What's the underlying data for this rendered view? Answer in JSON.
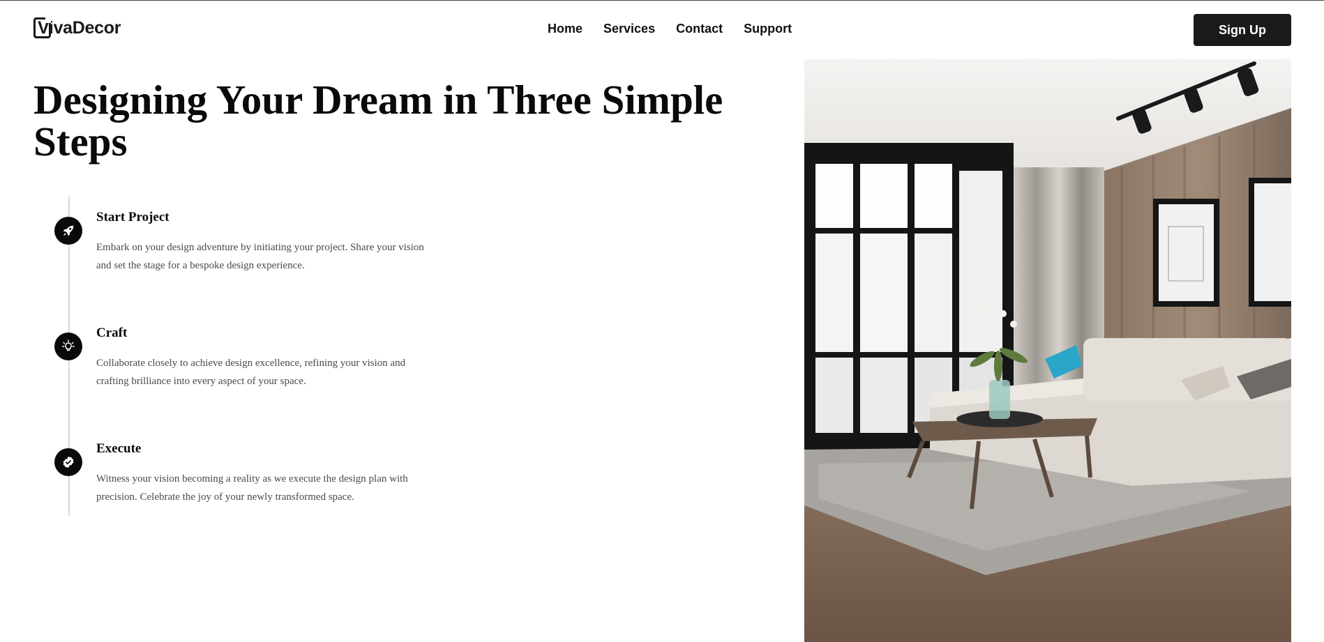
{
  "brand": {
    "name": "VivaDecor"
  },
  "nav": {
    "items": [
      "Home",
      "Services",
      "Contact",
      "Support"
    ]
  },
  "header": {
    "signup_label": "Sign Up"
  },
  "hero": {
    "title": "Designing Your Dream in Three Simple Steps"
  },
  "steps": [
    {
      "icon": "rocket-icon",
      "title": "Start Project",
      "description": "Embark on your design adventure by initiating your project. Share your vision and set the stage for a bespoke design experience."
    },
    {
      "icon": "lightbulb-icon",
      "title": "Craft",
      "description": "Collaborate closely to achieve design excellence, refining your vision and crafting brilliance into every aspect of your space."
    },
    {
      "icon": "check-badge-icon",
      "title": "Execute",
      "description": "Witness your vision becoming a reality as we execute the design plan with precision. Celebrate the joy of your newly transformed space."
    }
  ],
  "colors": {
    "accent": "#1a1a1a",
    "text_muted": "#4a4a4a",
    "timeline": "#d9d9d9"
  }
}
